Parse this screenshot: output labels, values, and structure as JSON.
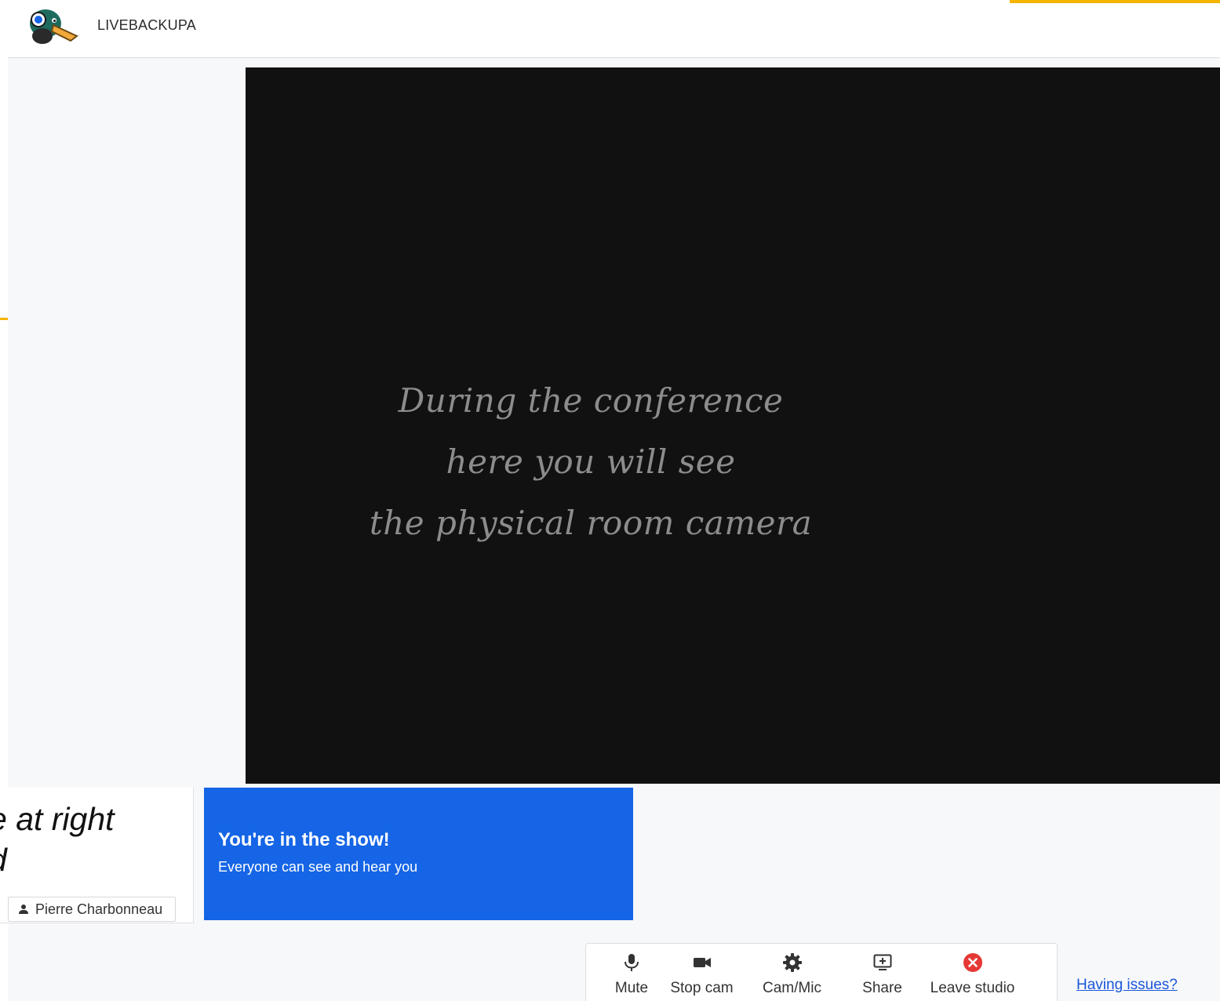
{
  "header": {
    "brand": "LIVEBACKUPA",
    "logo_icon": "duck-logo-icon",
    "accent_color": "#f4b400"
  },
  "stage": {
    "lines": [
      "During the conference",
      "here you will see",
      "the physical room camera"
    ],
    "background": "#111111"
  },
  "self_view": {
    "overlay_lines": [
      "e at right",
      "d"
    ],
    "participant_name": "Pierre Charbonneau",
    "person_icon": "person-icon"
  },
  "banner": {
    "title": "You're in the show!",
    "subtitle": "Everyone can see and hear you",
    "color": "#1565e6"
  },
  "toolbar": {
    "items": [
      {
        "label": "Mute",
        "icon": "microphone-icon"
      },
      {
        "label": "Stop cam",
        "icon": "camera-icon"
      },
      {
        "label": "Cam/Mic",
        "icon": "gear-icon"
      },
      {
        "label": "Share",
        "icon": "screen-share-icon"
      },
      {
        "label": "Leave studio",
        "icon": "close-circle-icon"
      }
    ],
    "leave_color": "#e53935"
  },
  "help": {
    "link_label": "Having issues?"
  }
}
